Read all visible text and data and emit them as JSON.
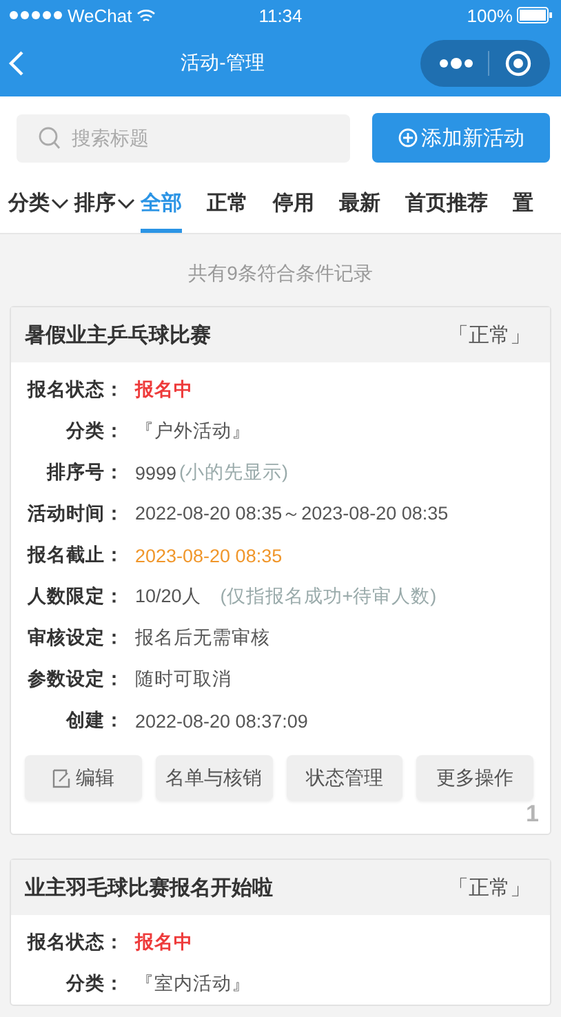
{
  "status_bar": {
    "carrier": "WeChat",
    "time": "11:34",
    "battery": "100%"
  },
  "nav": {
    "title": "活动-管理"
  },
  "search": {
    "placeholder": "搜索标题"
  },
  "add_button": {
    "label": "添加新活动"
  },
  "tabs": [
    {
      "label": "分类",
      "kind": "dropdown",
      "selected": false
    },
    {
      "label": "排序",
      "kind": "dropdown",
      "selected": false
    },
    {
      "label": "全部",
      "kind": "tab",
      "selected": true
    },
    {
      "label": "正常",
      "kind": "tab",
      "selected": false
    },
    {
      "label": "停用",
      "kind": "tab",
      "selected": false
    },
    {
      "label": "最新",
      "kind": "tab",
      "selected": false
    },
    {
      "label": "首页推荐",
      "kind": "tab",
      "selected": false
    },
    {
      "label": "置",
      "kind": "tab",
      "selected": false
    }
  ],
  "summary": "共有9条符合条件记录",
  "cards": [
    {
      "title": "暑假业主乒乓球比赛",
      "status": "「正常」",
      "rows": [
        {
          "label": "报名状态：",
          "value": "报名中",
          "kind": "status"
        },
        {
          "label": "分类：",
          "value": "『户外活动』",
          "kind": "plain"
        },
        {
          "label": "排序号：",
          "value": "9999",
          "note": "(小的先显示)",
          "kind": "plain"
        },
        {
          "label": "活动时间：",
          "value": "2022-08-20 08:35～2023-08-20 08:35",
          "kind": "plain"
        },
        {
          "label": "报名截止：",
          "value": "2023-08-20 08:35",
          "kind": "deadline"
        },
        {
          "label": "人数限定：",
          "value": "10/20人",
          "note": "(仅指报名成功+待审人数)",
          "kind": "plain"
        },
        {
          "label": "审核设定：",
          "value": "报名后无需审核",
          "kind": "plain"
        },
        {
          "label": "参数设定：",
          "value": "随时可取消",
          "kind": "plain"
        },
        {
          "label": "创建：",
          "value": "2022-08-20 08:37:09",
          "kind": "plain"
        }
      ],
      "actions": [
        {
          "label": "编辑",
          "kind": "edit"
        },
        {
          "label": "名单与核销",
          "kind": "plain"
        },
        {
          "label": "状态管理",
          "kind": "plain"
        },
        {
          "label": "更多操作",
          "kind": "plain"
        }
      ],
      "index": "1"
    },
    {
      "title": "业主羽毛球比赛报名开始啦",
      "status": "「正常」",
      "rows": [
        {
          "label": "报名状态：",
          "value": "报名中",
          "kind": "status"
        },
        {
          "label": "分类：",
          "value": "『室内活动』",
          "kind": "plain"
        }
      ]
    }
  ]
}
